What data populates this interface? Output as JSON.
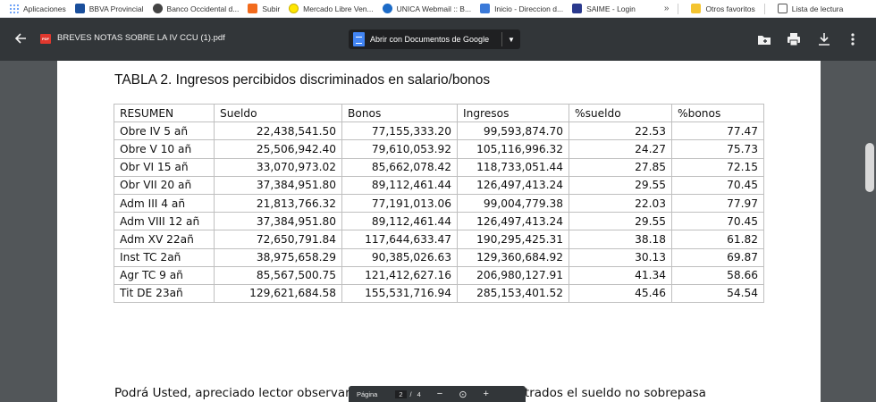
{
  "bookmarks": {
    "items": [
      {
        "label": "Aplicaciones"
      },
      {
        "label": "BBVA Provincial"
      },
      {
        "label": "Banco Occidental d..."
      },
      {
        "label": "Subir"
      },
      {
        "label": "Mercado Libre Ven..."
      },
      {
        "label": "UNICA Webmail :: B..."
      },
      {
        "label": "Inicio - Direccion d..."
      },
      {
        "label": "SAIME - Login"
      }
    ],
    "more": "»",
    "others": "Otros favoritos",
    "reading_list": "Lista de lectura"
  },
  "toolbar": {
    "file_badge": "PDF",
    "file_name": "BREVES NOTAS SOBRE LA IV CCU (1).pdf",
    "open_with": "Abrir con Documentos de Google"
  },
  "document": {
    "table_title": "TABLA 2. Ingresos percibidos discriminados en salario/bonos",
    "table": {
      "headers": [
        "RESUMEN",
        "Sueldo",
        "Bonos",
        "Ingresos",
        "%sueldo",
        "%bonos"
      ],
      "rows": [
        [
          "Obre IV 5 añ",
          "22,438,541.50",
          "77,155,333.20",
          "99,593,874.70",
          "22.53",
          "77.47"
        ],
        [
          "Obre V 10 añ",
          "25,506,942.40",
          "79,610,053.92",
          "105,116,996.32",
          "24.27",
          "75.73"
        ],
        [
          "Obr VI 15 añ",
          "33,070,973.02",
          "85,662,078.42",
          "118,733,051.44",
          "27.85",
          "72.15"
        ],
        [
          "Obr VII 20 añ",
          "37,384,951.80",
          "89,112,461.44",
          "126,497,413.24",
          "29.55",
          "70.45"
        ],
        [
          "Adm III 4 añ",
          "21,813,766.32",
          "77,191,013.06",
          "99,004,779.38",
          "22.03",
          "77.97"
        ],
        [
          "Adm VIII 12 añ",
          "37,384,951.80",
          "89,112,461.44",
          "126,497,413.24",
          "29.55",
          "70.45"
        ],
        [
          "Adm XV 22añ",
          "72,650,791.84",
          "117,644,633.47",
          "190,295,425.31",
          "38.18",
          "61.82"
        ],
        [
          "Inst TC 2añ",
          "38,975,658.29",
          "90,385,026.63",
          "129,360,684.92",
          "30.13",
          "69.87"
        ],
        [
          "Agr TC 9 añ",
          "85,567,500.75",
          "121,412,627.16",
          "206,980,127.91",
          "41.34",
          "58.66"
        ],
        [
          "Tit DE 23añ",
          "129,621,684.58",
          "155,531,716.94",
          "285,153,401.52",
          "45.46",
          "54.54"
        ]
      ]
    },
    "body_text": "Podrá Usted, apreciado lector observar que, en todos los casos mostrados el sueldo no sobrepasa"
  },
  "page_controls": {
    "label": "Página",
    "current": "2",
    "separator": "/",
    "total": "4",
    "zoom_out": "−",
    "zoom_fit": "⊙",
    "zoom_in": "+"
  }
}
